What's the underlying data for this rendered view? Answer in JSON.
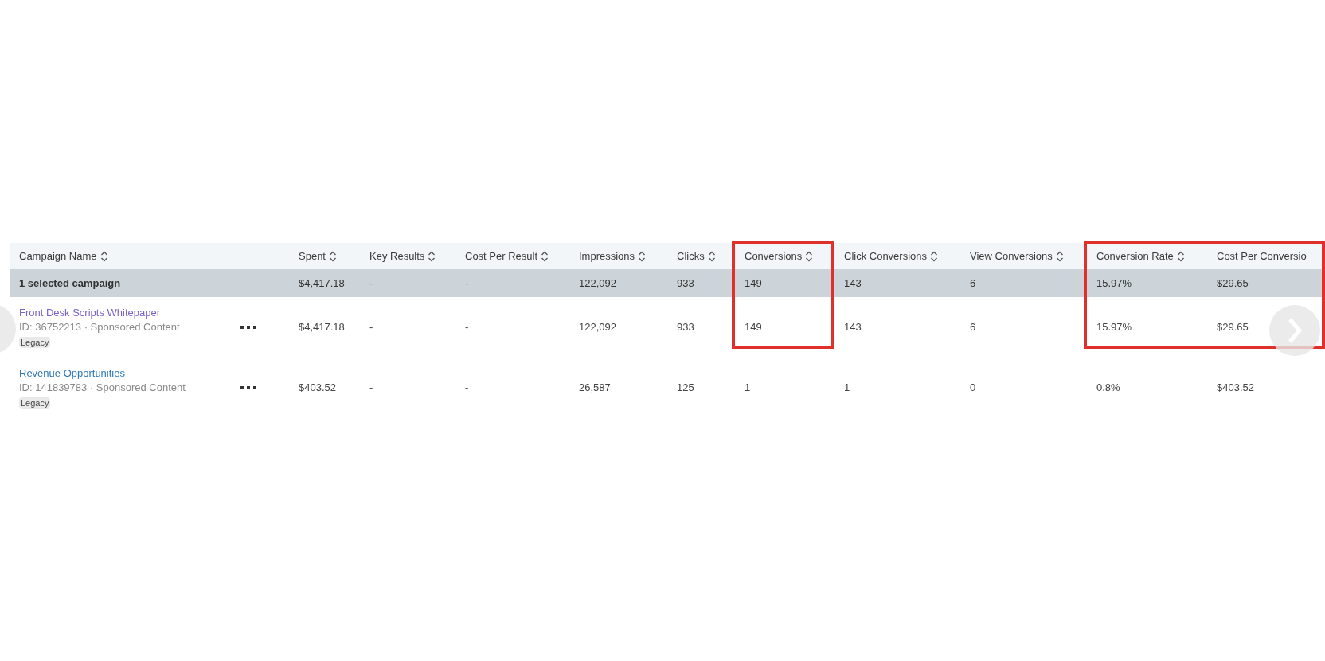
{
  "columns": [
    {
      "label": "Campaign Name",
      "highlighted": false
    },
    {
      "label": "Spent",
      "highlighted": false
    },
    {
      "label": "Key Results",
      "highlighted": false
    },
    {
      "label": "Cost Per Result",
      "highlighted": false
    },
    {
      "label": "Impressions",
      "highlighted": false
    },
    {
      "label": "Clicks",
      "highlighted": false
    },
    {
      "label": "Conversions",
      "highlighted": true
    },
    {
      "label": "Click Conversions",
      "highlighted": false
    },
    {
      "label": "View Conversions",
      "highlighted": false
    },
    {
      "label": "Conversion Rate",
      "highlighted": true
    },
    {
      "label": "Cost Per Conversio",
      "highlighted": true
    }
  ],
  "summary": {
    "label": "1 selected campaign",
    "cells": [
      "$4,417.18",
      "-",
      "-",
      "122,092",
      "933",
      "149",
      "143",
      "6",
      "15.97%",
      "$29.65"
    ]
  },
  "campaigns": [
    {
      "name": "Front Desk Scripts Whitepaper",
      "visited": true,
      "id_line": "ID: 36752213 · Sponsored Content",
      "badge": "Legacy",
      "cells": [
        "$4,417.18",
        "-",
        "-",
        "122,092",
        "933",
        "149",
        "143",
        "6",
        "15.97%",
        "$29.65"
      ]
    },
    {
      "name": "Revenue Opportunities",
      "visited": false,
      "id_line": "ID: 141839783 · Sponsored Content",
      "badge": "Legacy",
      "cells": [
        "$403.52",
        "-",
        "-",
        "26,587",
        "125",
        "1",
        "1",
        "0",
        "0.8%",
        "$403.52"
      ]
    }
  ]
}
